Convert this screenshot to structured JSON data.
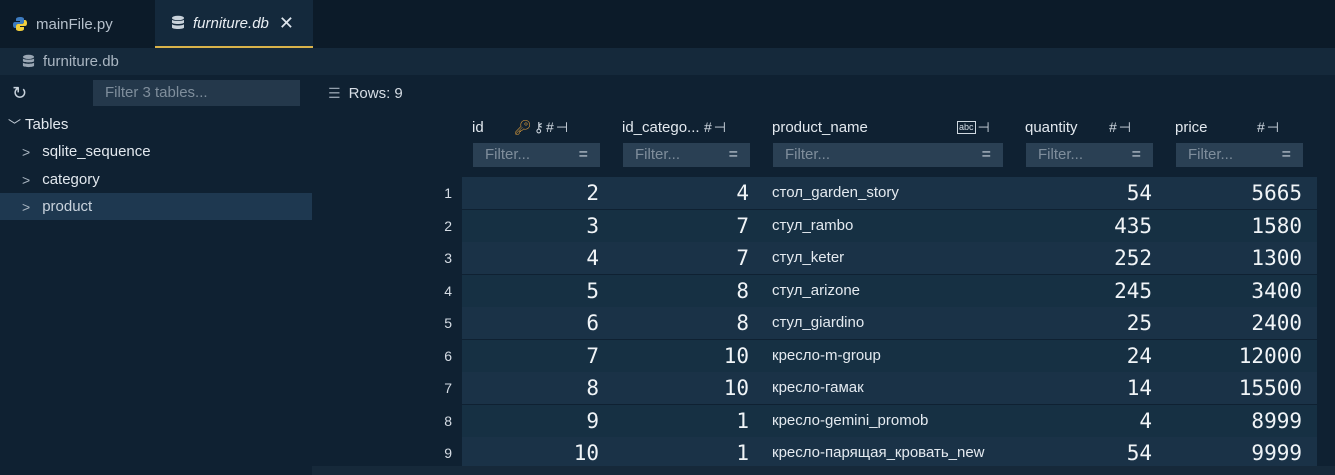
{
  "tabs": [
    {
      "label": "mainFile.py",
      "icon": "python-icon"
    },
    {
      "label": "furniture.db",
      "icon": "database-icon",
      "close": "✕"
    }
  ],
  "breadcrumb": {
    "label": "furniture.db"
  },
  "sidebar": {
    "filter_placeholder": "Filter 3 tables...",
    "root_label": "Tables",
    "items": [
      {
        "label": "sqlite_sequence"
      },
      {
        "label": "category"
      },
      {
        "label": "product"
      }
    ]
  },
  "grid": {
    "rows_info": "Rows: 9",
    "filter_placeholder": "Filter...",
    "columns": [
      {
        "label": "id"
      },
      {
        "label": "id_catego..."
      },
      {
        "label": "product_name"
      },
      {
        "label": "quantity"
      },
      {
        "label": "price"
      }
    ],
    "rows": [
      {
        "n": "1",
        "id": "2",
        "id_category": "4",
        "product_name": "стол_garden_story",
        "quantity": "54",
        "price": "5665"
      },
      {
        "n": "2",
        "id": "3",
        "id_category": "7",
        "product_name": "стул_rambo",
        "quantity": "435",
        "price": "1580"
      },
      {
        "n": "3",
        "id": "4",
        "id_category": "7",
        "product_name": "стул_keter",
        "quantity": "252",
        "price": "1300"
      },
      {
        "n": "4",
        "id": "5",
        "id_category": "8",
        "product_name": "стул_arizone",
        "quantity": "245",
        "price": "3400"
      },
      {
        "n": "5",
        "id": "6",
        "id_category": "8",
        "product_name": "стул_giardino",
        "quantity": "25",
        "price": "2400"
      },
      {
        "n": "6",
        "id": "7",
        "id_category": "10",
        "product_name": "кресло-m-group",
        "quantity": "24",
        "price": "12000"
      },
      {
        "n": "7",
        "id": "8",
        "id_category": "10",
        "product_name": "кресло-гамак",
        "quantity": "14",
        "price": "15500"
      },
      {
        "n": "8",
        "id": "9",
        "id_category": "1",
        "product_name": "кресло-gemini_promob",
        "quantity": "4",
        "price": "8999"
      },
      {
        "n": "9",
        "id": "10",
        "id_category": "1",
        "product_name": "кресло-парящая_кровать_new",
        "quantity": "54",
        "price": "9999"
      }
    ]
  },
  "colors": {
    "accent_tab_underline": "#d9b24a",
    "key_icon": "#e7a23b"
  }
}
